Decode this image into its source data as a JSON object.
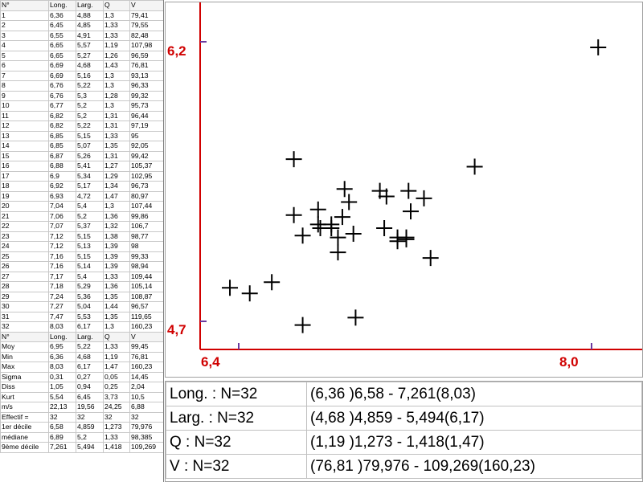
{
  "grid": {
    "headers": [
      "N°",
      "Long.",
      "Larg.",
      "Q",
      "V"
    ],
    "rows": [
      [
        "1",
        "6,36",
        "4,88",
        "1,3",
        "79,41"
      ],
      [
        "2",
        "6,45",
        "4,85",
        "1,33",
        "79,55"
      ],
      [
        "3",
        "6,55",
        "4,91",
        "1,33",
        "82,48"
      ],
      [
        "4",
        "6,65",
        "5,57",
        "1,19",
        "107,98"
      ],
      [
        "5",
        "6,65",
        "5,27",
        "1,26",
        "96,59"
      ],
      [
        "6",
        "6,69",
        "4,68",
        "1,43",
        "76,81"
      ],
      [
        "7",
        "6,69",
        "5,16",
        "1,3",
        "93,13"
      ],
      [
        "8",
        "6,76",
        "5,22",
        "1,3",
        "96,33"
      ],
      [
        "9",
        "6,76",
        "5,3",
        "1,28",
        "99,32"
      ],
      [
        "10",
        "6,77",
        "5,2",
        "1,3",
        "95,73"
      ],
      [
        "11",
        "6,82",
        "5,2",
        "1,31",
        "96,44"
      ],
      [
        "12",
        "6,82",
        "5,22",
        "1,31",
        "97,19"
      ],
      [
        "13",
        "6,85",
        "5,15",
        "1,33",
        "95"
      ],
      [
        "14",
        "6,85",
        "5,07",
        "1,35",
        "92,05"
      ],
      [
        "15",
        "6,87",
        "5,26",
        "1,31",
        "99,42"
      ],
      [
        "16",
        "6,88",
        "5,41",
        "1,27",
        "105,37"
      ],
      [
        "17",
        "6,9",
        "5,34",
        "1,29",
        "102,95"
      ],
      [
        "18",
        "6,92",
        "5,17",
        "1,34",
        "96,73"
      ],
      [
        "19",
        "6,93",
        "4,72",
        "1,47",
        "80,97"
      ],
      [
        "20",
        "7,04",
        "5,4",
        "1,3",
        "107,44"
      ],
      [
        "21",
        "7,06",
        "5,2",
        "1,36",
        "99,86"
      ],
      [
        "22",
        "7,07",
        "5,37",
        "1,32",
        "106,7"
      ],
      [
        "23",
        "7,12",
        "5,15",
        "1,38",
        "98,77"
      ],
      [
        "24",
        "7,12",
        "5,13",
        "1,39",
        "98"
      ],
      [
        "25",
        "7,16",
        "5,15",
        "1,39",
        "99,33"
      ],
      [
        "26",
        "7,16",
        "5,14",
        "1,39",
        "98,94"
      ],
      [
        "27",
        "7,17",
        "5,4",
        "1,33",
        "109,44"
      ],
      [
        "28",
        "7,18",
        "5,29",
        "1,36",
        "105,14"
      ],
      [
        "29",
        "7,24",
        "5,36",
        "1,35",
        "108,87"
      ],
      [
        "30",
        "7,27",
        "5,04",
        "1,44",
        "96,57"
      ],
      [
        "31",
        "7,47",
        "5,53",
        "1,35",
        "119,65"
      ],
      [
        "32",
        "8,03",
        "6,17",
        "1,3",
        "160,23"
      ]
    ],
    "stats_header": [
      "N°",
      "Long.",
      "Larg.",
      "Q",
      "V"
    ],
    "stats": [
      [
        "Moy",
        "6,95",
        "5,22",
        "1,33",
        "99,45"
      ],
      [
        "Min",
        "6,36",
        "4,68",
        "1,19",
        "76,81"
      ],
      [
        "Max",
        "8,03",
        "6,17",
        "1,47",
        "160,23"
      ],
      [
        "Sigma",
        "0,31",
        "0,27",
        "0,05",
        "14,45"
      ],
      [
        "Diss",
        "1,05",
        "0,94",
        "0,25",
        "2,04"
      ],
      [
        "Kurt",
        "5,54",
        "6,45",
        "3,73",
        "10,5"
      ],
      [
        "m/s",
        "22,13",
        "19,56",
        "24,25",
        "6,88"
      ],
      [
        "Effectif =",
        "32",
        "32",
        "32",
        "32"
      ],
      [
        "1er décile",
        "6,58",
        "4,859",
        "1,273",
        "79,976"
      ],
      [
        "médiane",
        "6,89",
        "5,2",
        "1,33",
        "98,385"
      ],
      [
        "9ème décile",
        "7,261",
        "5,494",
        "1,418",
        "109,269"
      ]
    ]
  },
  "plot": {
    "y_top_label": "6,2",
    "y_bottom_label": "4,7",
    "x_left_label": "6,4",
    "x_right_label": "8,0",
    "axis_color": "#d00000",
    "marker_color": "#000000"
  },
  "chart_data": {
    "type": "scatter",
    "x_field": "Long.",
    "y_field": "Larg.",
    "xlim": [
      6.4,
      8.0
    ],
    "ylim": [
      4.7,
      6.2
    ],
    "points": [
      [
        6.36,
        4.88
      ],
      [
        6.45,
        4.85
      ],
      [
        6.55,
        4.91
      ],
      [
        6.65,
        5.57
      ],
      [
        6.65,
        5.27
      ],
      [
        6.69,
        4.68
      ],
      [
        6.69,
        5.16
      ],
      [
        6.76,
        5.22
      ],
      [
        6.76,
        5.3
      ],
      [
        6.77,
        5.2
      ],
      [
        6.82,
        5.2
      ],
      [
        6.82,
        5.22
      ],
      [
        6.85,
        5.15
      ],
      [
        6.85,
        5.07
      ],
      [
        6.87,
        5.26
      ],
      [
        6.88,
        5.41
      ],
      [
        6.9,
        5.34
      ],
      [
        6.92,
        5.17
      ],
      [
        6.93,
        4.72
      ],
      [
        7.04,
        5.4
      ],
      [
        7.06,
        5.2
      ],
      [
        7.07,
        5.37
      ],
      [
        7.12,
        5.15
      ],
      [
        7.12,
        5.13
      ],
      [
        7.16,
        5.15
      ],
      [
        7.16,
        5.14
      ],
      [
        7.17,
        5.4
      ],
      [
        7.18,
        5.29
      ],
      [
        7.24,
        5.36
      ],
      [
        7.27,
        5.04
      ],
      [
        7.47,
        5.53
      ],
      [
        8.03,
        6.17
      ]
    ]
  },
  "summary": {
    "rows": [
      {
        "label": "Long. : N=32",
        "value": "(6,36 )6,58 - 7,261(8,03)"
      },
      {
        "label": "Larg. : N=32",
        "value": "(4,68 )4,859 - 5,494(6,17)"
      },
      {
        "label": "Q : N=32",
        "value": "(1,19 )1,273 - 1,418(1,47)"
      },
      {
        "label": "V : N=32",
        "value": "(76,81 )79,976 - 109,269(160,23)"
      }
    ]
  }
}
